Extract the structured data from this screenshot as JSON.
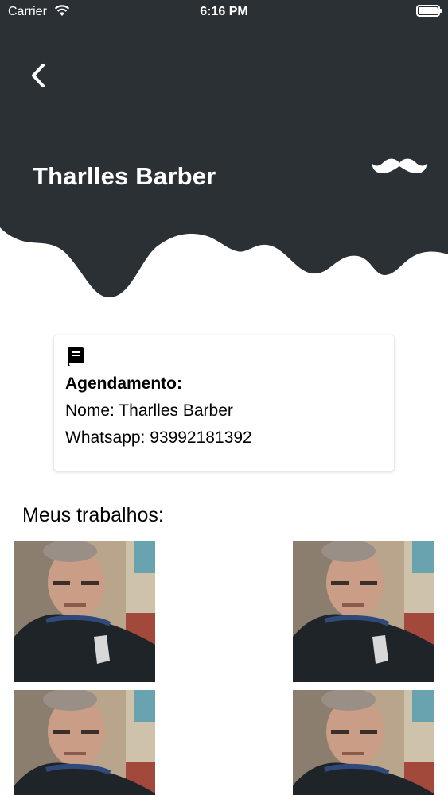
{
  "status_bar": {
    "carrier": "Carrier",
    "time": "6:16 PM"
  },
  "header": {
    "title": "Tharlles Barber",
    "background_color": "#2b3035",
    "back_icon": "chevron-left-icon",
    "brand_icon": "mustache-icon"
  },
  "booking_card": {
    "icon": "book-icon",
    "heading": "Agendamento:",
    "name_line": "Nome: Tharlles Barber",
    "whatsapp_line": "Whatsapp: 93992181392"
  },
  "works": {
    "title": "Meus trabalhos:",
    "photos": [
      "haircut photo",
      "haircut photo",
      "haircut photo",
      "haircut photo"
    ]
  }
}
